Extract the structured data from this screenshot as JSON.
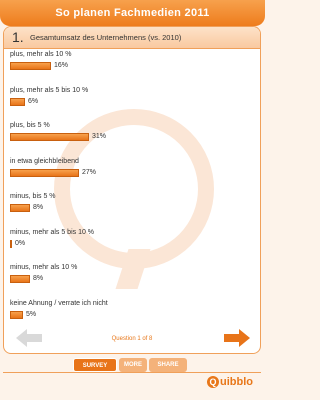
{
  "header": {
    "title": "So planen Fachmedien 2011"
  },
  "question": {
    "number": "1.",
    "text": "Gesamtumsatz des Unternehmens (vs. 2010)"
  },
  "answers": [
    {
      "label": "plus, mehr als 10 %",
      "pct_label": "16%",
      "value": 16
    },
    {
      "label": "plus, mehr als 5 bis 10 %",
      "pct_label": "6%",
      "value": 6
    },
    {
      "label": "plus, bis 5 %",
      "pct_label": "31%",
      "value": 31
    },
    {
      "label": "in etwa gleichbleibend",
      "pct_label": "27%",
      "value": 27
    },
    {
      "label": "minus, bis 5 %",
      "pct_label": "8%",
      "value": 8
    },
    {
      "label": "minus, mehr als 5 bis 10 %",
      "pct_label": "0%",
      "value": 0
    },
    {
      "label": "minus, mehr als 10 %",
      "pct_label": "8%",
      "value": 8
    },
    {
      "label": "keine Ahnung / verrate ich nicht",
      "pct_label": "5%",
      "value": 5
    }
  ],
  "pager": {
    "text": "Question 1 of 8"
  },
  "tabs": {
    "survey": "SURVEY",
    "more": "MORE",
    "share": "SHARE"
  },
  "brand": {
    "name": "uibblo",
    "mark": "Q"
  },
  "icons": {
    "prev": "arrow-left-icon",
    "next": "arrow-right-icon"
  },
  "colors": {
    "accent": "#e87419",
    "accent_light": "#f4b27a",
    "prev_disabled": "#d9d9d9"
  }
}
